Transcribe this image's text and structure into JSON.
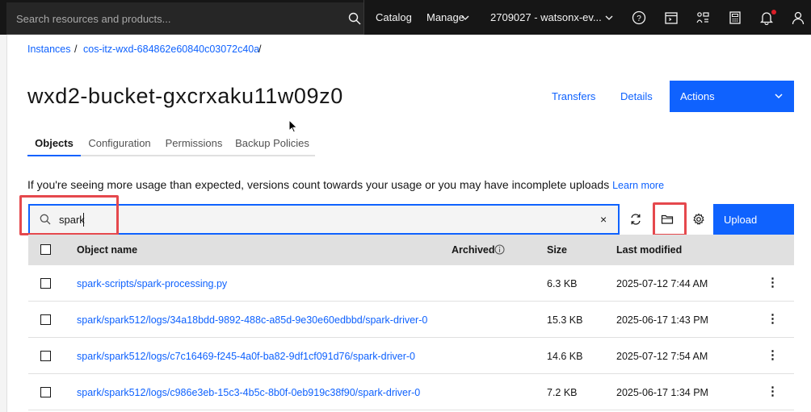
{
  "topbar": {
    "search_placeholder": "Search resources and products...",
    "catalog": "Catalog",
    "manage": "Manage",
    "account": "2709027 - watsonx-ev...",
    "icons": [
      "search-icon",
      "help-icon",
      "cost-estimator-icon",
      "switcher-icon",
      "calculator-icon",
      "notification-icon",
      "user-icon"
    ]
  },
  "breadcrumb": {
    "instances": "Instances",
    "sep": "/",
    "instance": "cos-itz-wxd-684862e60840c03072c40a",
    "sep2": "/"
  },
  "page": {
    "title": "wxd2-bucket-gxcrxaku11w09z0",
    "transfers": "Transfers",
    "details": "Details",
    "actions": "Actions"
  },
  "tabs": [
    {
      "label": "Objects",
      "active": true
    },
    {
      "label": "Configuration",
      "active": false
    },
    {
      "label": "Permissions",
      "active": false
    },
    {
      "label": "Backup Policies",
      "active": false
    }
  ],
  "notice": {
    "text": "If you're seeing more usage than expected, versions count towards your usage or you may have incomplete uploads",
    "link": "Learn more"
  },
  "object_search": {
    "value": "spark",
    "clear": "×"
  },
  "toolbar": {
    "upload": "Upload"
  },
  "table": {
    "headers": {
      "name": "Object name",
      "archived": "Archived",
      "size": "Size",
      "modified": "Last modified"
    },
    "rows": [
      {
        "name": "spark-scripts/spark-processing.py",
        "size": "6.3 KB",
        "modified": "2025-07-12 7:44 AM"
      },
      {
        "name": "spark/spark512/logs/34a18bdd-9892-488c-a85d-9e30e60edbbd/spark-driver-0",
        "size": "15.3 KB",
        "modified": "2025-06-17 1:43 PM"
      },
      {
        "name": "spark/spark512/logs/c7c16469-f245-4a0f-ba82-9df1cf091d76/spark-driver-0",
        "size": "14.6 KB",
        "modified": "2025-07-12 7:54 AM"
      },
      {
        "name": "spark/spark512/logs/c986e3eb-15c3-4b5c-8b0f-0eb919c38f90/spark-driver-0",
        "size": "7.2 KB",
        "modified": "2025-06-17 1:34 PM"
      }
    ],
    "overflow": "⋮"
  },
  "colors": {
    "topbar": "#161616",
    "primary": "#0f62fe",
    "highlight": "#e5484d",
    "notification": "#da1e28"
  }
}
